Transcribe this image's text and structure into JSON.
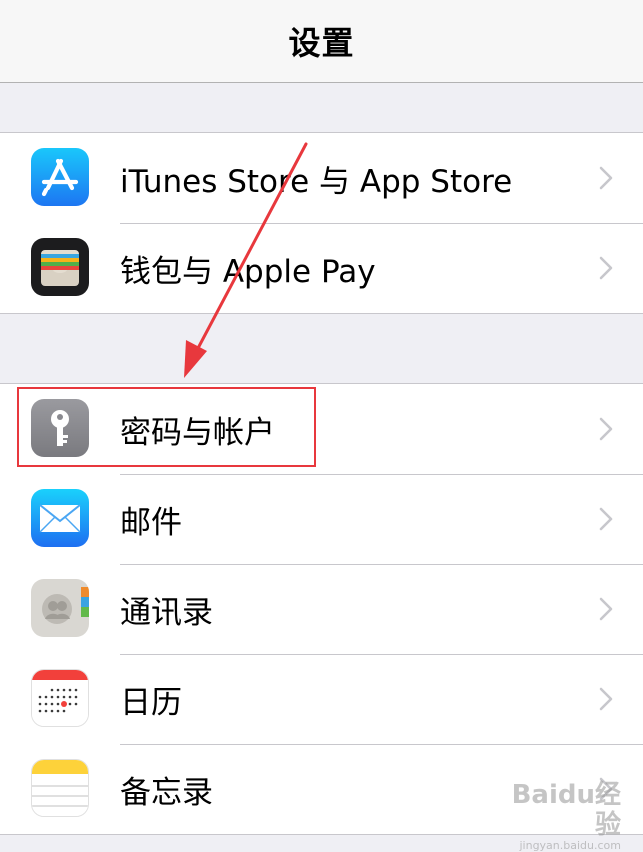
{
  "navbar": {
    "title": "设置"
  },
  "groups": [
    {
      "items": [
        {
          "label": "iTunes Store 与 App Store",
          "icon": "app-store-icon"
        },
        {
          "label": "钱包与 Apple Pay",
          "icon": "wallet-icon"
        }
      ]
    },
    {
      "items": [
        {
          "label": "密码与帐户",
          "icon": "passwords-key-icon"
        },
        {
          "label": "邮件",
          "icon": "mail-icon"
        },
        {
          "label": "通讯录",
          "icon": "contacts-icon"
        },
        {
          "label": "日历",
          "icon": "calendar-icon"
        },
        {
          "label": "备忘录",
          "icon": "notes-icon"
        }
      ]
    }
  ],
  "annotation": {
    "highlight_color": "#e8383d",
    "highlighted_item": "密码与帐户"
  },
  "watermark": {
    "main": "Baidu经验",
    "sub": "jingyan.baidu.com"
  },
  "colors": {
    "background": "#efeff4",
    "separator": "#c8c7cc",
    "chevron": "#c7c7cc"
  }
}
